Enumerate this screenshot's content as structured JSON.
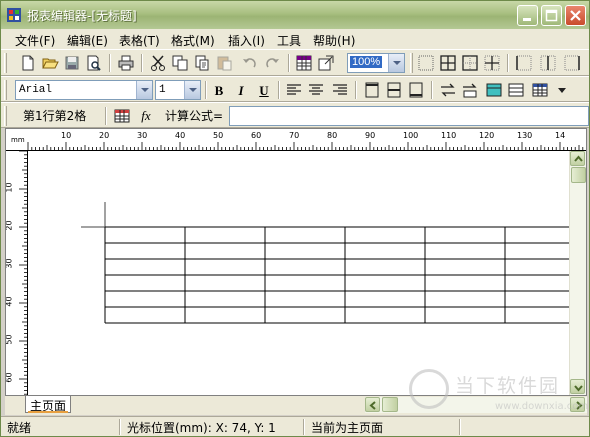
{
  "window": {
    "title": "报表编辑器-[无标题]"
  },
  "menu": [
    {
      "label": "文件(F)"
    },
    {
      "label": "编辑(E)"
    },
    {
      "label": "表格(T)"
    },
    {
      "label": "格式(M)"
    },
    {
      "label": "插入(I)"
    },
    {
      "label": "工具"
    },
    {
      "label": "帮助(H)"
    }
  ],
  "toolbar": {
    "zoom_value": "100%",
    "font_name": "Arial",
    "font_size": "1",
    "bold_label": "B",
    "italic_label": "I",
    "underline_label": "U"
  },
  "formula_bar": {
    "cell_ref": "第1行第2格",
    "fx_label": "fx",
    "formula_label": "计算公式=",
    "formula_value": ""
  },
  "ruler": {
    "unit": "mm",
    "h_labels": [
      "10",
      "20",
      "30",
      "40",
      "50",
      "60",
      "70",
      "80",
      "90",
      "100",
      "110",
      "120",
      "130",
      "14"
    ],
    "v_labels": [
      "10",
      "20",
      "30",
      "40",
      "50",
      "60"
    ]
  },
  "sheet_tabs": [
    {
      "label": "主页面"
    }
  ],
  "status": {
    "state": "就绪",
    "cursor": "光标位置(mm):  X: 74, Y: 1",
    "current": "当前为主页面"
  },
  "watermark": {
    "text": "当下软件园",
    "url": "www.downxia.com"
  }
}
